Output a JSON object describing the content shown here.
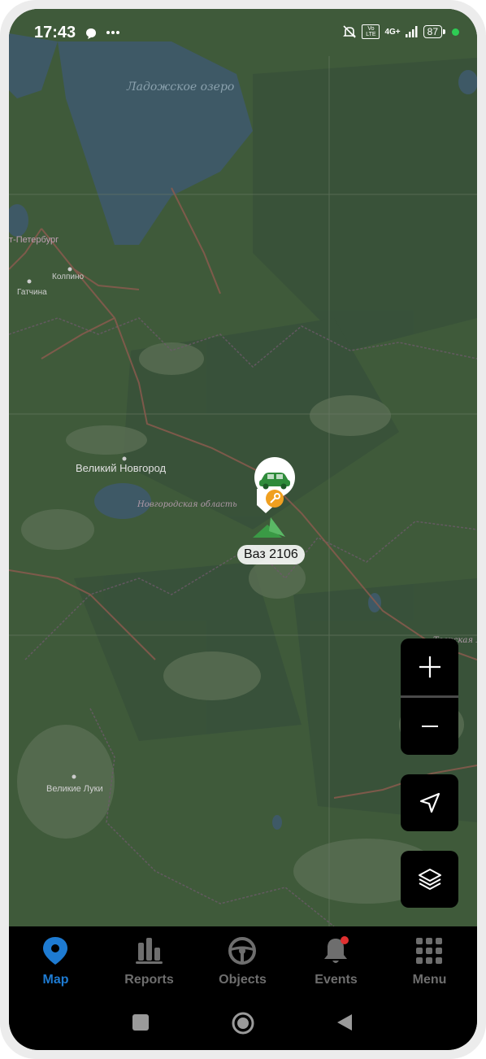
{
  "status_bar": {
    "time": "17:43",
    "network": "4G+",
    "volte": "Vo LTE",
    "battery": "87"
  },
  "map": {
    "labels": {
      "lake": "Ладожское озеро",
      "spb": "т-Петербург",
      "kolpino": "Колпино",
      "gatchina": "Гатчина",
      "novgorod": "Великий Новгород",
      "region_novgorod": "Новгородская область",
      "velikie_luki": "Великие Луки",
      "region_tver": "Тверская ласть"
    },
    "vehicle": {
      "name": "Ваз 2106",
      "accent_color": "#f0a020",
      "car_color": "#2e8b3a"
    }
  },
  "controls": {
    "zoom_in": "+",
    "zoom_out": "−",
    "locate_icon": "navigation-arrow-icon",
    "layers_icon": "layers-icon"
  },
  "bottom_nav": {
    "active_color": "#1e7bd2",
    "items": [
      {
        "label": "Map",
        "icon": "map-pin-icon",
        "active": true
      },
      {
        "label": "Reports",
        "icon": "bar-chart-icon",
        "active": false
      },
      {
        "label": "Objects",
        "icon": "steering-wheel-icon",
        "active": false
      },
      {
        "label": "Events",
        "icon": "bell-icon",
        "active": false
      },
      {
        "label": "Menu",
        "icon": "grid-icon",
        "active": false
      }
    ]
  }
}
